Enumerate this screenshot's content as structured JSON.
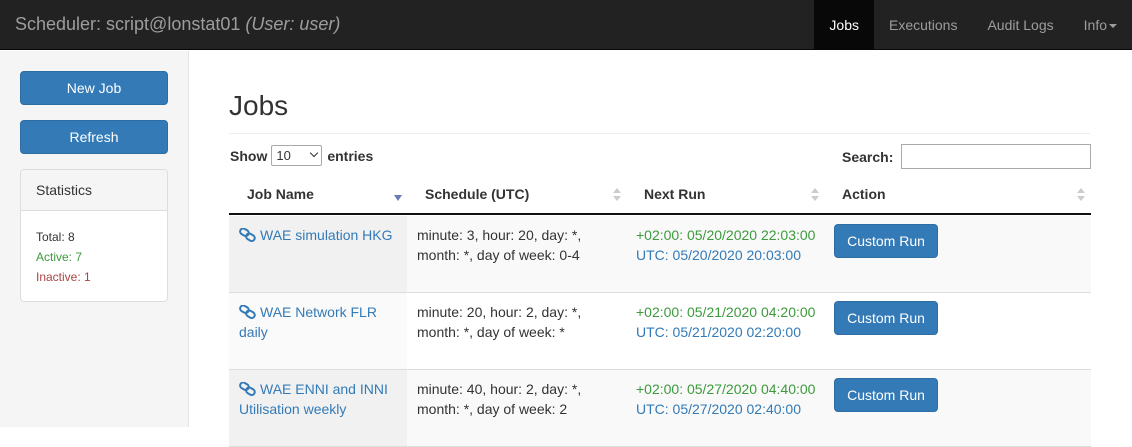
{
  "navbar": {
    "brand_prefix": "Scheduler: script@lonstat01",
    "brand_user": "(User: user)",
    "items": [
      {
        "label": "Jobs",
        "active": true
      },
      {
        "label": "Executions",
        "active": false
      },
      {
        "label": "Audit Logs",
        "active": false
      },
      {
        "label": "Info",
        "active": false,
        "dropdown": true
      }
    ]
  },
  "sidebar": {
    "new_job_label": "New Job",
    "refresh_label": "Refresh",
    "stats": {
      "heading": "Statistics",
      "total": "Total: 8",
      "active": "Active: 7",
      "inactive": "Inactive: 1"
    }
  },
  "main": {
    "title": "Jobs",
    "show_label": "Show",
    "entries_value": "10",
    "entries_label": "entries",
    "search_label": "Search:",
    "search_value": "",
    "columns": [
      "Job Name",
      "Schedule (UTC)",
      "Next Run",
      "Action"
    ],
    "rows": [
      {
        "name": "WAE simulation HKG",
        "schedule": "minute: 3, hour: 20, day: *, month: *, day of week: 0-4",
        "next_local": "+02:00: 05/20/2020 22:03:00",
        "next_utc": "UTC: 05/20/2020 20:03:00",
        "action": "Custom Run"
      },
      {
        "name": "WAE Network FLR daily",
        "schedule": "minute: 20, hour: 2, day: *, month: *, day of week: *",
        "next_local": "+02:00: 05/21/2020 04:20:00",
        "next_utc": "UTC: 05/21/2020 02:20:00",
        "action": "Custom Run"
      },
      {
        "name": "WAE ENNI and INNI Utilisation weekly",
        "schedule": "minute: 40, hour: 2, day: *, month: *, day of week: 2",
        "next_local": "+02:00: 05/27/2020 04:40:00",
        "next_utc": "UTC: 05/27/2020 02:40:00",
        "action": "Custom Run"
      }
    ]
  },
  "colors": {
    "navbar_bg": "#222222",
    "primary": "#337ab7",
    "success_text": "#3c9a3c",
    "danger_text": "#a94442"
  }
}
